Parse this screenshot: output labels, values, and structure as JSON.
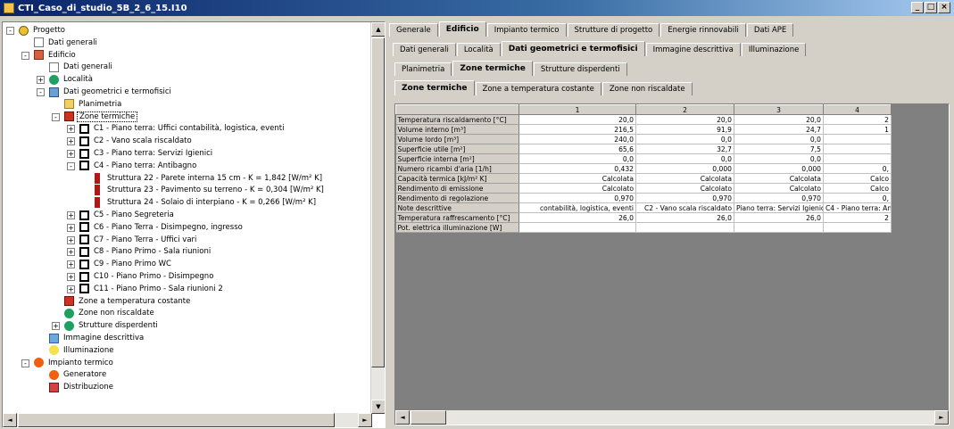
{
  "window": {
    "title": "CTI_Caso_di_studio_5B_2_6_15.I10",
    "min": "_",
    "max": "□",
    "close": "×"
  },
  "tree": [
    {
      "label": "Progetto",
      "icon": "gear-icon",
      "level": 0,
      "exp": "-"
    },
    {
      "label": "Dati generali",
      "icon": "document-icon",
      "level": 1,
      "exp": ""
    },
    {
      "label": "Edificio",
      "icon": "house-icon",
      "level": 1,
      "exp": "-"
    },
    {
      "label": "Dati generali",
      "icon": "document-icon",
      "level": 2,
      "exp": ""
    },
    {
      "label": "Località",
      "icon": "location-icon",
      "level": 2,
      "exp": "+"
    },
    {
      "label": "Dati geometrici e termofisici",
      "icon": "geometry-icon",
      "level": 2,
      "exp": "-"
    },
    {
      "label": "Planimetria",
      "icon": "floorplan-icon",
      "level": 3,
      "exp": ""
    },
    {
      "label": "Zone termiche",
      "icon": "thermal-zone-icon",
      "level": 3,
      "exp": "-",
      "selected": true
    },
    {
      "label": "C1 - Piano terra: Uffici contabilità, logistica, eventi",
      "icon": "zone-bracket-icon",
      "level": 4,
      "exp": "+"
    },
    {
      "label": "C2 - Vano scala riscaldato",
      "icon": "zone-bracket-icon",
      "level": 4,
      "exp": "+"
    },
    {
      "label": "C3 - Piano terra: Servizi Igienici",
      "icon": "zone-bracket-icon",
      "level": 4,
      "exp": "+"
    },
    {
      "label": "C4 - Piano terra: Antibagno",
      "icon": "zone-bracket-icon",
      "level": 4,
      "exp": "-"
    },
    {
      "label": "Struttura 22 - Parete interna 15 cm - K = 1,842 [W/m² K]",
      "icon": "wall-icon",
      "level": 5,
      "exp": ""
    },
    {
      "label": "Struttura 23 - Pavimento su terreno - K = 0,304 [W/m² K]",
      "icon": "wall-icon",
      "level": 5,
      "exp": ""
    },
    {
      "label": "Struttura 24 - Solaio di interpiano - K = 0,266 [W/m² K]",
      "icon": "wall-icon",
      "level": 5,
      "exp": ""
    },
    {
      "label": "C5 - Piano Segreteria",
      "icon": "zone-bracket-icon",
      "level": 4,
      "exp": "+"
    },
    {
      "label": "C6 - Piano Terra - Disimpegno, ingresso",
      "icon": "zone-bracket-icon",
      "level": 4,
      "exp": "+"
    },
    {
      "label": "C7 - Piano Terra - Uffici vari",
      "icon": "zone-bracket-icon",
      "level": 4,
      "exp": "+"
    },
    {
      "label": "C8 - Piano Primo - Sala riunioni",
      "icon": "zone-bracket-icon",
      "level": 4,
      "exp": "+"
    },
    {
      "label": "C9 - Piano Primo WC",
      "icon": "zone-bracket-icon",
      "level": 4,
      "exp": "+"
    },
    {
      "label": "C10 - Piano Primo - Disimpegno",
      "icon": "zone-bracket-icon",
      "level": 4,
      "exp": "+"
    },
    {
      "label": "C11 - Piano Primo - Sala riunioni 2",
      "icon": "zone-bracket-icon",
      "level": 4,
      "exp": "+"
    },
    {
      "label": "Zone a temperatura costante",
      "icon": "thermal-zone-icon",
      "level": 3,
      "exp": ""
    },
    {
      "label": "Zone non riscaldate",
      "icon": "unheated-zone-icon",
      "level": 3,
      "exp": ""
    },
    {
      "label": "Strutture disperdenti",
      "icon": "structure-icon",
      "level": 3,
      "exp": "+"
    },
    {
      "label": "Immagine descrittiva",
      "icon": "image-icon",
      "level": 2,
      "exp": ""
    },
    {
      "label": "Illuminazione",
      "icon": "bulb-icon",
      "level": 2,
      "exp": ""
    },
    {
      "label": "Impianto termico",
      "icon": "flame-icon",
      "level": 1,
      "exp": "-"
    },
    {
      "label": "Generatore",
      "icon": "generator-icon",
      "level": 2,
      "exp": ""
    },
    {
      "label": "Distribuzione",
      "icon": "distribution-icon",
      "level": 2,
      "exp": ""
    }
  ],
  "tabs1": [
    "Generale",
    "Edificio",
    "Impianto termico",
    "Strutture di progetto",
    "Energie rinnovabili",
    "Dati APE"
  ],
  "tabs1_active": 1,
  "tabs2": [
    "Dati generali",
    "Località",
    "Dati geometrici e termofisici",
    "Immagine descrittiva",
    "Illuminazione"
  ],
  "tabs2_active": 2,
  "tabs3": [
    "Planimetria",
    "Zone termiche",
    "Strutture disperdenti"
  ],
  "tabs3_active": 1,
  "tabs4": [
    "Zone termiche",
    "Zone a temperatura costante",
    "Zone non riscaldate"
  ],
  "tabs4_active": 0,
  "grid": {
    "columns": [
      "",
      "1",
      "2",
      "3",
      "4"
    ],
    "rows": [
      {
        "label": "Temperatura riscaldamento [°C]",
        "values": [
          "20,0",
          "20,0",
          "20,0",
          "2"
        ]
      },
      {
        "label": "Volume interno [m³]",
        "values": [
          "216,5",
          "91,9",
          "24,7",
          "1"
        ]
      },
      {
        "label": "Volume lordo [m³]",
        "values": [
          "240,0",
          "0,0",
          "0,0",
          ""
        ]
      },
      {
        "label": "Superficie utile [m²]",
        "values": [
          "65,6",
          "32,7",
          "7,5",
          ""
        ]
      },
      {
        "label": "Superficie interna [m²]",
        "values": [
          "0,0",
          "0,0",
          "0,0",
          ""
        ]
      },
      {
        "label": "Numero ricambi d'aria [1/h]",
        "values": [
          "0,432",
          "0,000",
          "0,000",
          "0,"
        ]
      },
      {
        "label": "Capacità termica [kJ/m² K]",
        "values": [
          "Calcolata",
          "Calcolata",
          "Calcolata",
          "Calco"
        ]
      },
      {
        "label": "Rendimento di emissione",
        "values": [
          "Calcolato",
          "Calcolato",
          "Calcolato",
          "Calco"
        ]
      },
      {
        "label": "Rendimento di regolazione",
        "values": [
          "0,970",
          "0,970",
          "0,970",
          "0,"
        ]
      },
      {
        "label": "Note descrittive",
        "values": [
          "contabilità, logistica, eventi",
          "C2 - Vano scala riscaldato",
          "Piano terra: Servizi Igienici",
          "C4 - Piano terra: Antiba"
        ]
      },
      {
        "label": "Temperatura raffrescamento [°C]",
        "values": [
          "26,0",
          "26,0",
          "26,0",
          "2"
        ]
      },
      {
        "label": "Pot. elettrica illuminazione [W]",
        "values": [
          "",
          "",
          "",
          ""
        ]
      }
    ]
  },
  "scroll": {
    "up": "▲",
    "down": "▼",
    "left": "◄",
    "right": "►"
  }
}
